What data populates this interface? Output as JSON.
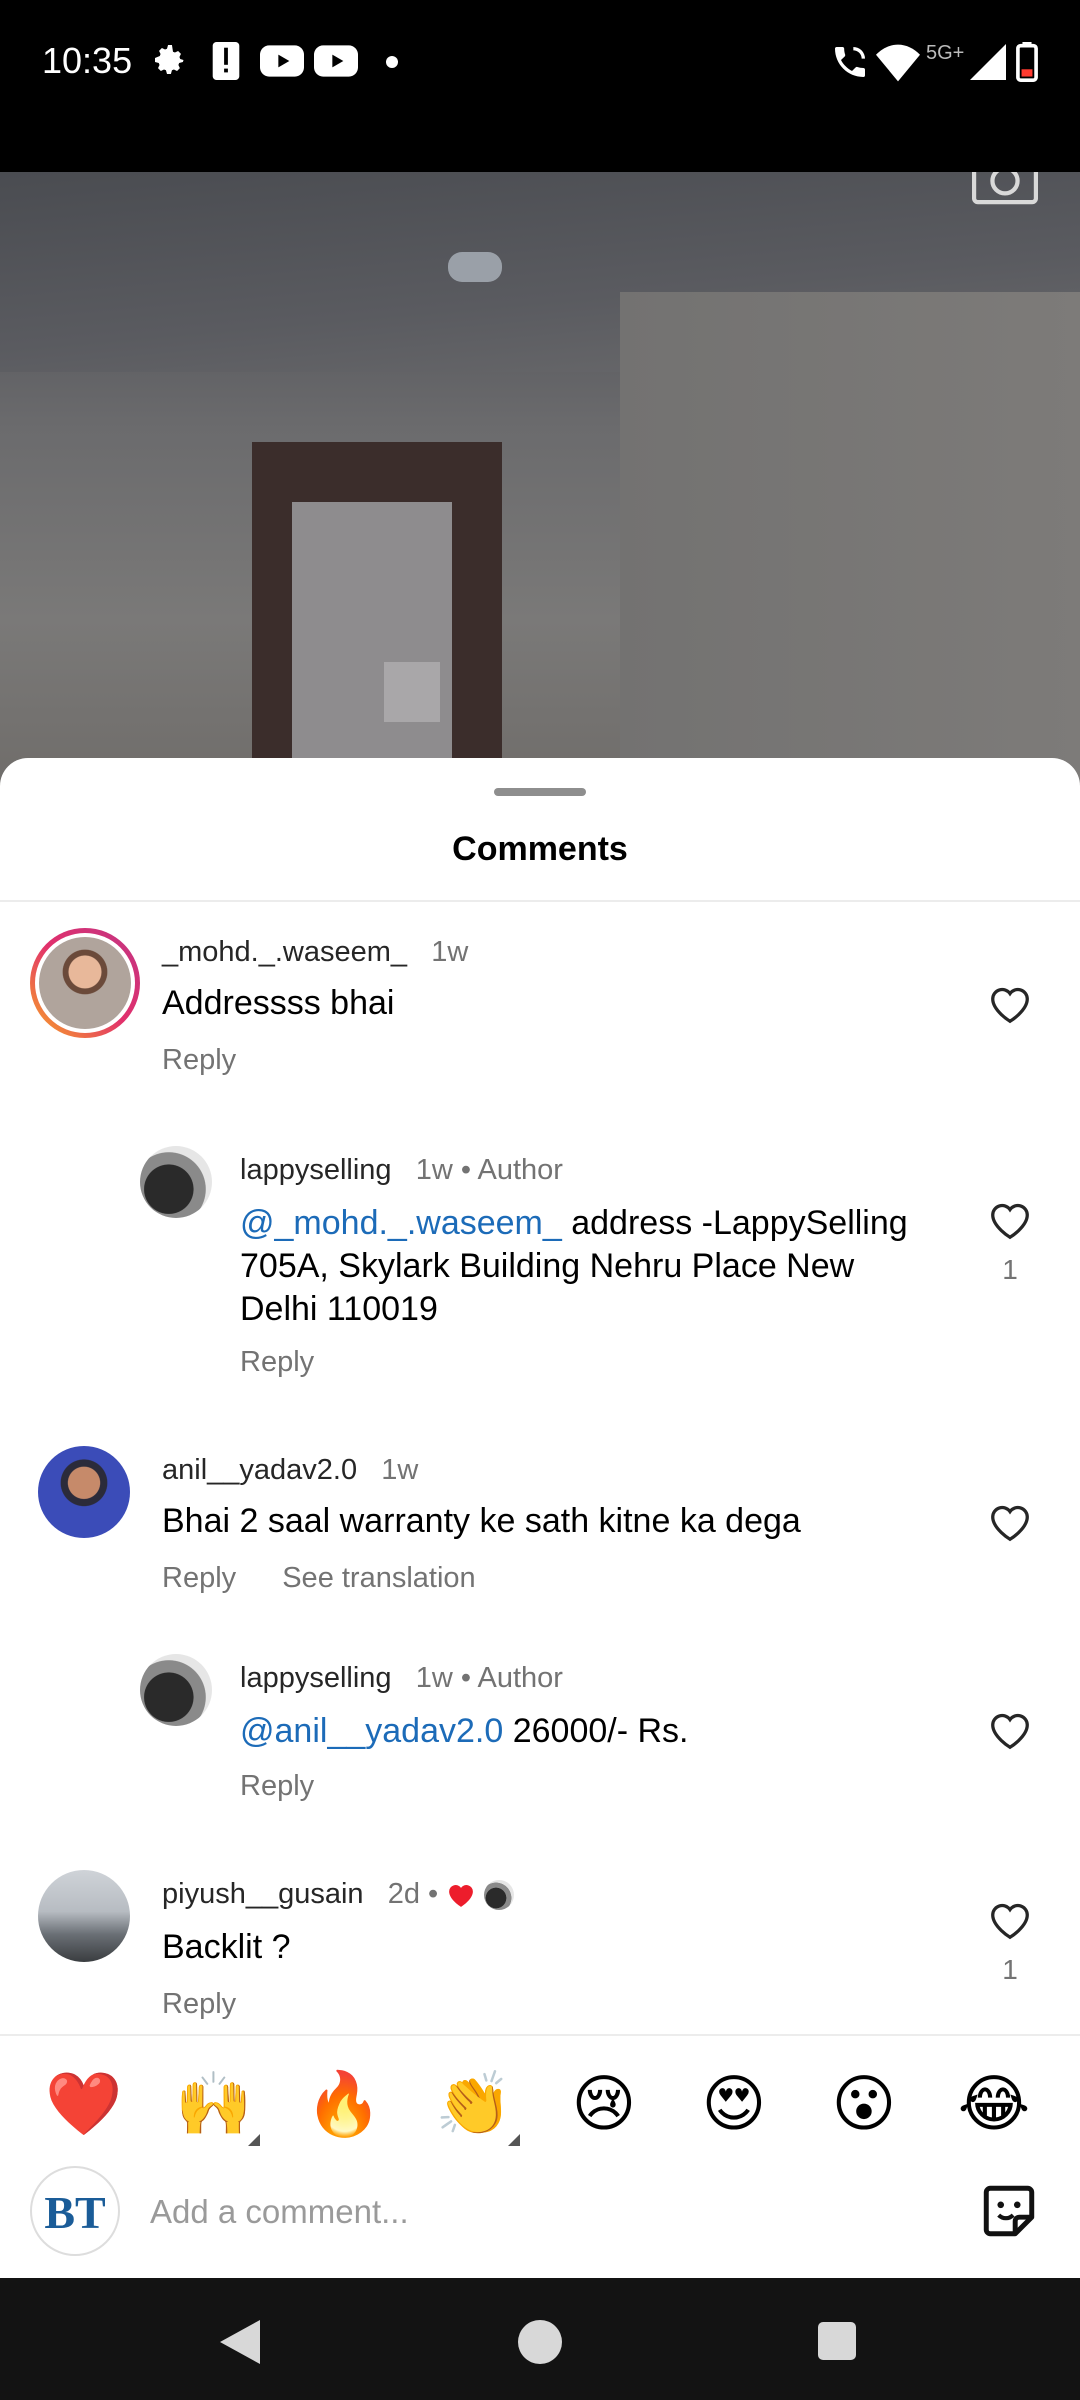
{
  "status_bar": {
    "time": "10:35",
    "network": "5G+",
    "icons": [
      "gear-icon",
      "alert-icon",
      "youtube-icon",
      "youtube-icon",
      "dot-icon",
      "wifi-call-icon",
      "wifi-icon",
      "signal-icon",
      "battery-icon"
    ]
  },
  "sheet": {
    "title": "Comments"
  },
  "comments": [
    {
      "username": "_mohd._.waseem_",
      "time": "1w",
      "text": "Addressss bhai",
      "reply": "Reply"
    },
    {
      "username": "lappyselling",
      "time": "1w",
      "author_tag": "Author",
      "mention": "@_mohd._.waseem_",
      "text_line1": " address -LappySelling",
      "text_line2": "705A, Skylark Building Nehru Place New",
      "text_line3": "Delhi 110019",
      "reply": "Reply",
      "likes": "1"
    },
    {
      "username": "anil__yadav2.0",
      "time": "1w",
      "text": "Bhai 2 saal warranty ke sath kitne ka dega",
      "reply": "Reply",
      "see_translation": "See translation"
    },
    {
      "username": "lappyselling",
      "time": "1w",
      "author_tag": "Author",
      "mention": "@anil__yadav2.0",
      "text": " 26000/- Rs.",
      "reply": "Reply"
    },
    {
      "username": "piyush__gusain",
      "time": "2d",
      "text": "Backlit ?",
      "reply": "Reply",
      "likes": "1"
    }
  ],
  "emoji_bar": [
    "❤️",
    "🙌",
    "🔥",
    "👏",
    "😢",
    "😍",
    "😮",
    "😂"
  ],
  "input": {
    "placeholder": "Add a comment...",
    "avatar_text": "BT"
  },
  "colors": {
    "mention": "#1c6bb8",
    "story_ring": "#d6249f",
    "heart": "#ed1d2c"
  }
}
